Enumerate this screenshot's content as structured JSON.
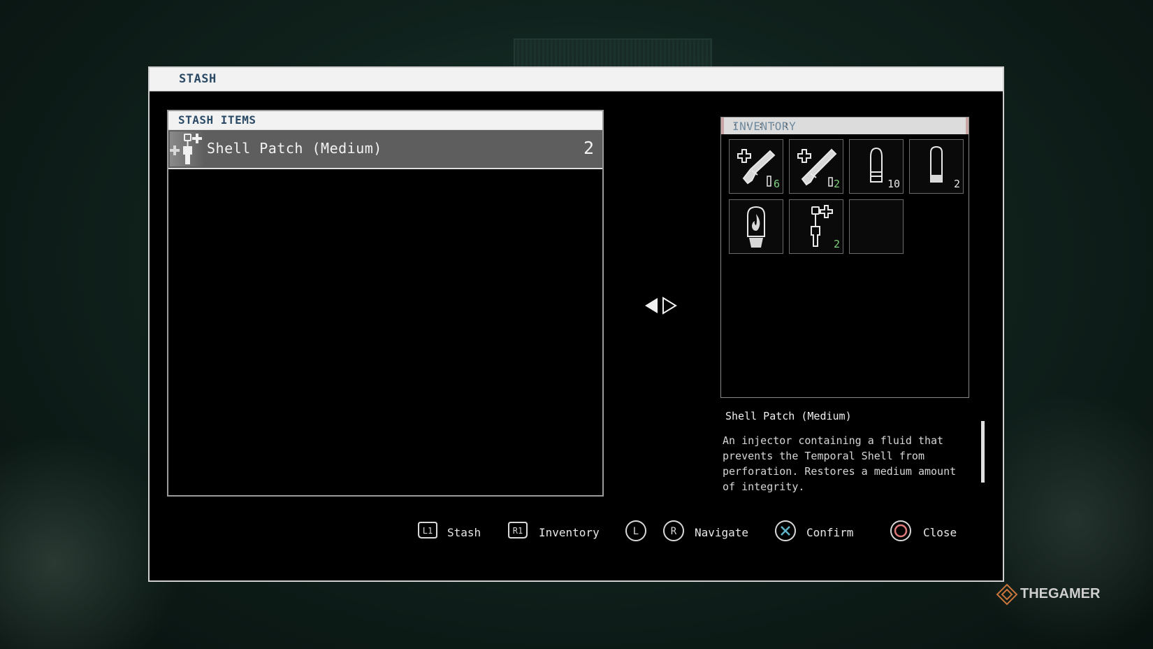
{
  "window": {
    "title": "STASH"
  },
  "stash": {
    "header": "STASH ITEMS",
    "items": [
      {
        "name": "Shell Patch (Medium)",
        "quantity": "2",
        "icon": "shell-patch-icon"
      }
    ]
  },
  "inventory": {
    "header": "INVENTORY",
    "slots": [
      {
        "icon": "pistol-icon",
        "quantity": "6",
        "sub_icon": "ammo-icon"
      },
      {
        "icon": "shotgun-icon",
        "quantity": "2",
        "sub_icon": "ammo-icon"
      },
      {
        "icon": "ammo-round-icon",
        "quantity": "10"
      },
      {
        "icon": "shotgun-shell-icon",
        "quantity": "2"
      },
      {
        "icon": "fire-grenade-icon",
        "quantity": ""
      },
      {
        "icon": "shell-patch-icon",
        "quantity": "2"
      },
      {
        "icon": "empty-slot",
        "quantity": ""
      }
    ]
  },
  "description": {
    "name": "Shell Patch (Medium)",
    "text": "An injector containing a fluid that prevents the Temporal Shell from perforation. Restores a medium amount of integrity."
  },
  "controls": [
    {
      "button": "L1",
      "label": "Stash"
    },
    {
      "button": "R1",
      "label": "Inventory"
    },
    {
      "button": "L",
      "label": ""
    },
    {
      "button": "R",
      "label": "Navigate"
    },
    {
      "button": "cross",
      "label": "Confirm"
    },
    {
      "button": "circle",
      "label": "Close"
    }
  ],
  "watermark": "THEGAMER",
  "colors": {
    "title_text": "#2b4a66",
    "header_bg": "#f2f2f2",
    "selected_row": "#5e5e5e",
    "cross_button": "#5fb3c9",
    "circle_button": "#e07a7a"
  }
}
